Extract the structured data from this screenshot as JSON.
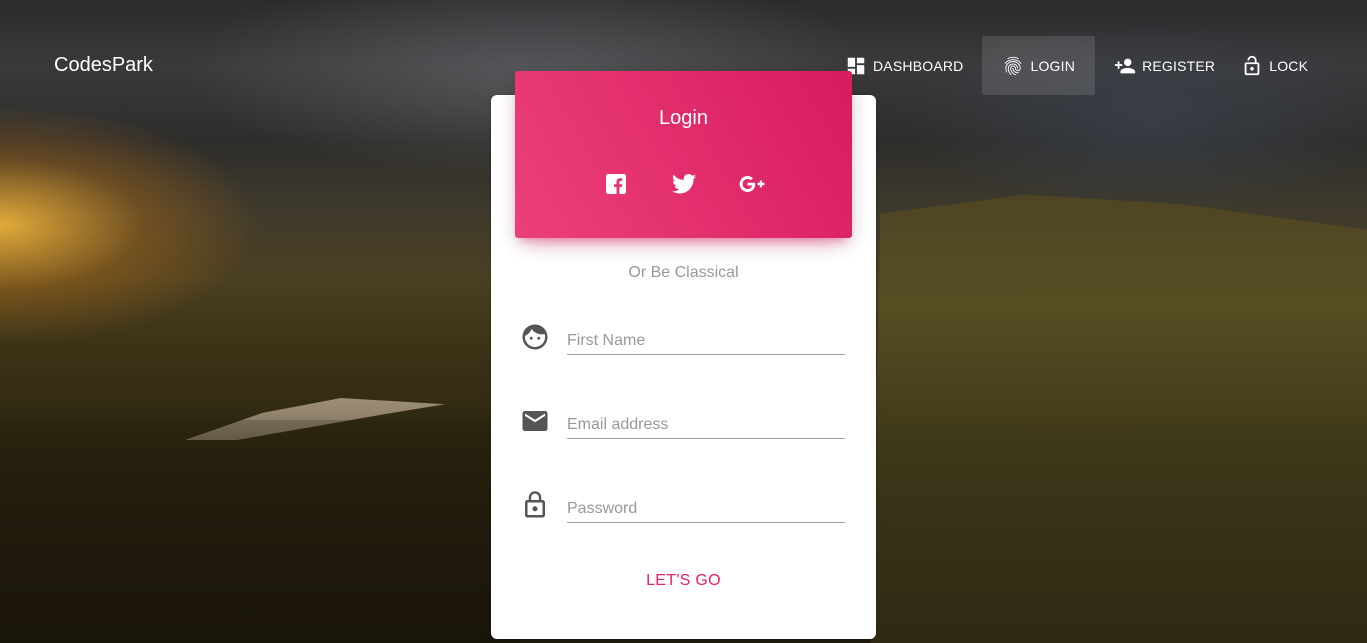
{
  "brand": "CodesPark",
  "nav": {
    "items": [
      {
        "label": "DASHBOARD",
        "icon": "dashboard-icon"
      },
      {
        "label": "LOGIN",
        "icon": "fingerprint-icon",
        "active": true
      },
      {
        "label": "REGISTER",
        "icon": "person-add-icon"
      },
      {
        "label": "LOCK",
        "icon": "lock-open-icon"
      }
    ]
  },
  "card": {
    "title": "Login",
    "social": [
      "facebook-icon",
      "twitter-icon",
      "google-plus-icon"
    ],
    "subtitle": "Or Be Classical",
    "fields": [
      {
        "placeholder": "First Name",
        "value": "",
        "icon": "face-icon"
      },
      {
        "placeholder": "Email address",
        "value": "",
        "icon": "email-icon"
      },
      {
        "placeholder": "Password",
        "value": "",
        "icon": "lock-icon"
      }
    ],
    "submit_label": "LET'S GO"
  },
  "colors": {
    "accent": "#e91e63",
    "header_start": "#ec407a",
    "header_end": "#d81b60"
  }
}
